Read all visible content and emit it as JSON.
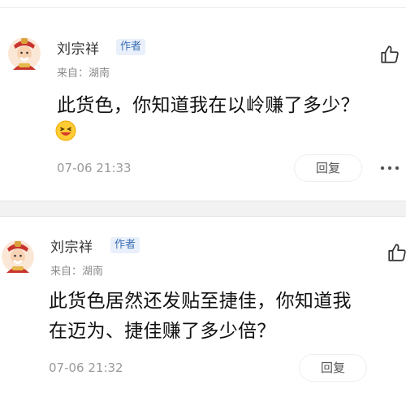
{
  "comments": [
    {
      "author": "刘宗祥",
      "badge": "作者",
      "region": "来自：湖南",
      "text_lines": [
        "此货色，你知道我在以岭赚了多少？"
      ],
      "has_emoji": true,
      "time": "07-06 21:33",
      "reply_label": "回复"
    },
    {
      "author": "刘宗祥",
      "badge": "作者",
      "region": "来自：湖南",
      "text_lines": [
        "此货色居然还发贴至捷佳，你知道我",
        "在迈为、捷佳赚了多少倍？"
      ],
      "has_emoji": false,
      "time": "07-06 21:32",
      "reply_label": "回复"
    }
  ],
  "icons": {
    "avatar": "god-of-wealth-avatar",
    "like": "thumbs-up-icon",
    "emoji": "grinning-face-emoji",
    "more": "more-dots-icon"
  },
  "colors": {
    "badge_text": "#3d6fb3",
    "badge_bg": "#e9f0fb",
    "meta_text": "#9a9a9a"
  }
}
